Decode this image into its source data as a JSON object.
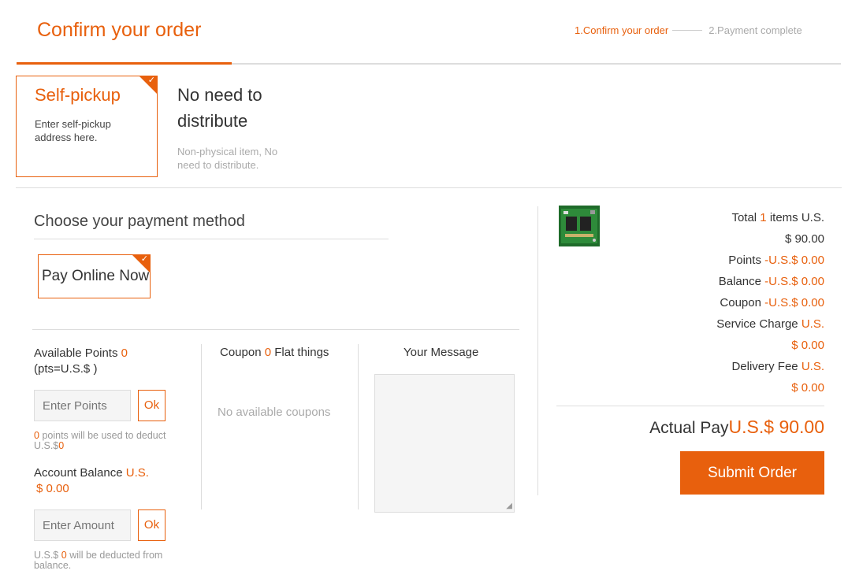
{
  "header": {
    "title": "Confirm your order",
    "steps": [
      "1.Confirm your order",
      "2.Payment complete"
    ]
  },
  "delivery": {
    "options": [
      {
        "title": "Self-pickup",
        "desc": "Enter self-pickup address here.",
        "selected": true
      },
      {
        "title": "No need to distribute",
        "desc": "Non-physical item, No need to distribute.",
        "selected": false
      }
    ]
  },
  "payment": {
    "heading": "Choose your payment method",
    "method": "Pay Online Now"
  },
  "points": {
    "label_prefix": "Available Points",
    "count": "0",
    "rate": "(pts=U.S.$ )",
    "placeholder": "Enter Points",
    "ok": "Ok",
    "note_count": "0",
    "note_mid": "points will be used to deduct U.S.$",
    "note_amount": "0"
  },
  "balance": {
    "label": "Account Balance",
    "currency": "U.S.",
    "amount": "$ 0.00",
    "placeholder": "Enter Amount",
    "ok": "Ok",
    "note_prefix": "U.S.$",
    "note_amount": "0",
    "note_suffix": "will be deducted from balance."
  },
  "coupon": {
    "label_prefix": "Coupon",
    "count": "0",
    "label_suffix": "Flat things",
    "empty": "No available coupons"
  },
  "message": {
    "label": "Your Message"
  },
  "summary": {
    "total_prefix": "Total",
    "item_count": "1",
    "total_suffix": "items U.S.",
    "total_amount": "$ 90.00",
    "points_label": "Points",
    "points_value": "-U.S.$ 0.00",
    "balance_label": "Balance",
    "balance_value": "-U.S.$ 0.00",
    "coupon_label": "Coupon",
    "coupon_value": "-U.S.$ 0.00",
    "service_label": "Service Charge",
    "service_currency": "U.S.",
    "service_value": "$ 0.00",
    "delivery_label": "Delivery Fee",
    "delivery_currency": "U.S.",
    "delivery_value": "$ 0.00",
    "actual_label": "Actual Pay",
    "actual_value": "U.S.$ 90.00",
    "submit": "Submit Order"
  },
  "colors": {
    "accent": "#e8600d",
    "divider": "#dddddd",
    "muted": "#999999"
  }
}
